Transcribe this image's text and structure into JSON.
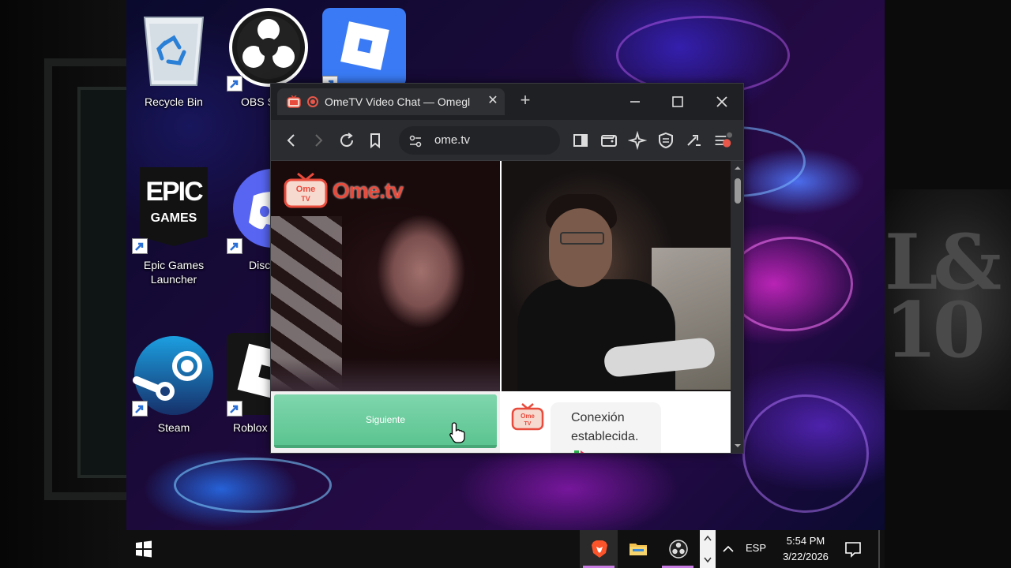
{
  "desktop": {
    "icons": [
      {
        "label": "Recycle Bin"
      },
      {
        "label": "OBS S"
      },
      {
        "label": "Epic Games Launcher"
      },
      {
        "label": "Disc"
      },
      {
        "label": "Steam"
      },
      {
        "label": "Roblox"
      }
    ],
    "epic_logo_text": "EPIC",
    "epic_logo_sub": "GAMES",
    "background_poster_text": "L&\n10"
  },
  "browser": {
    "tab_title": "OmeTV Video Chat — Omegl",
    "tab_close": "✕",
    "new_tab": "+",
    "url": "ome.tv",
    "page": {
      "logo_badge": "Ome TV",
      "logo_word": "Ome.tv",
      "next_button_label": "Siguiente",
      "chat_message": "Conexión establecida."
    }
  },
  "taskbar": {
    "language": "ESP",
    "time": "5:54 PM",
    "date": "3/22/2026"
  },
  "colors": {
    "accent_green": "#5bc490",
    "ome_red": "#e84b3c",
    "taskbar_indicator": "#c57be0"
  }
}
